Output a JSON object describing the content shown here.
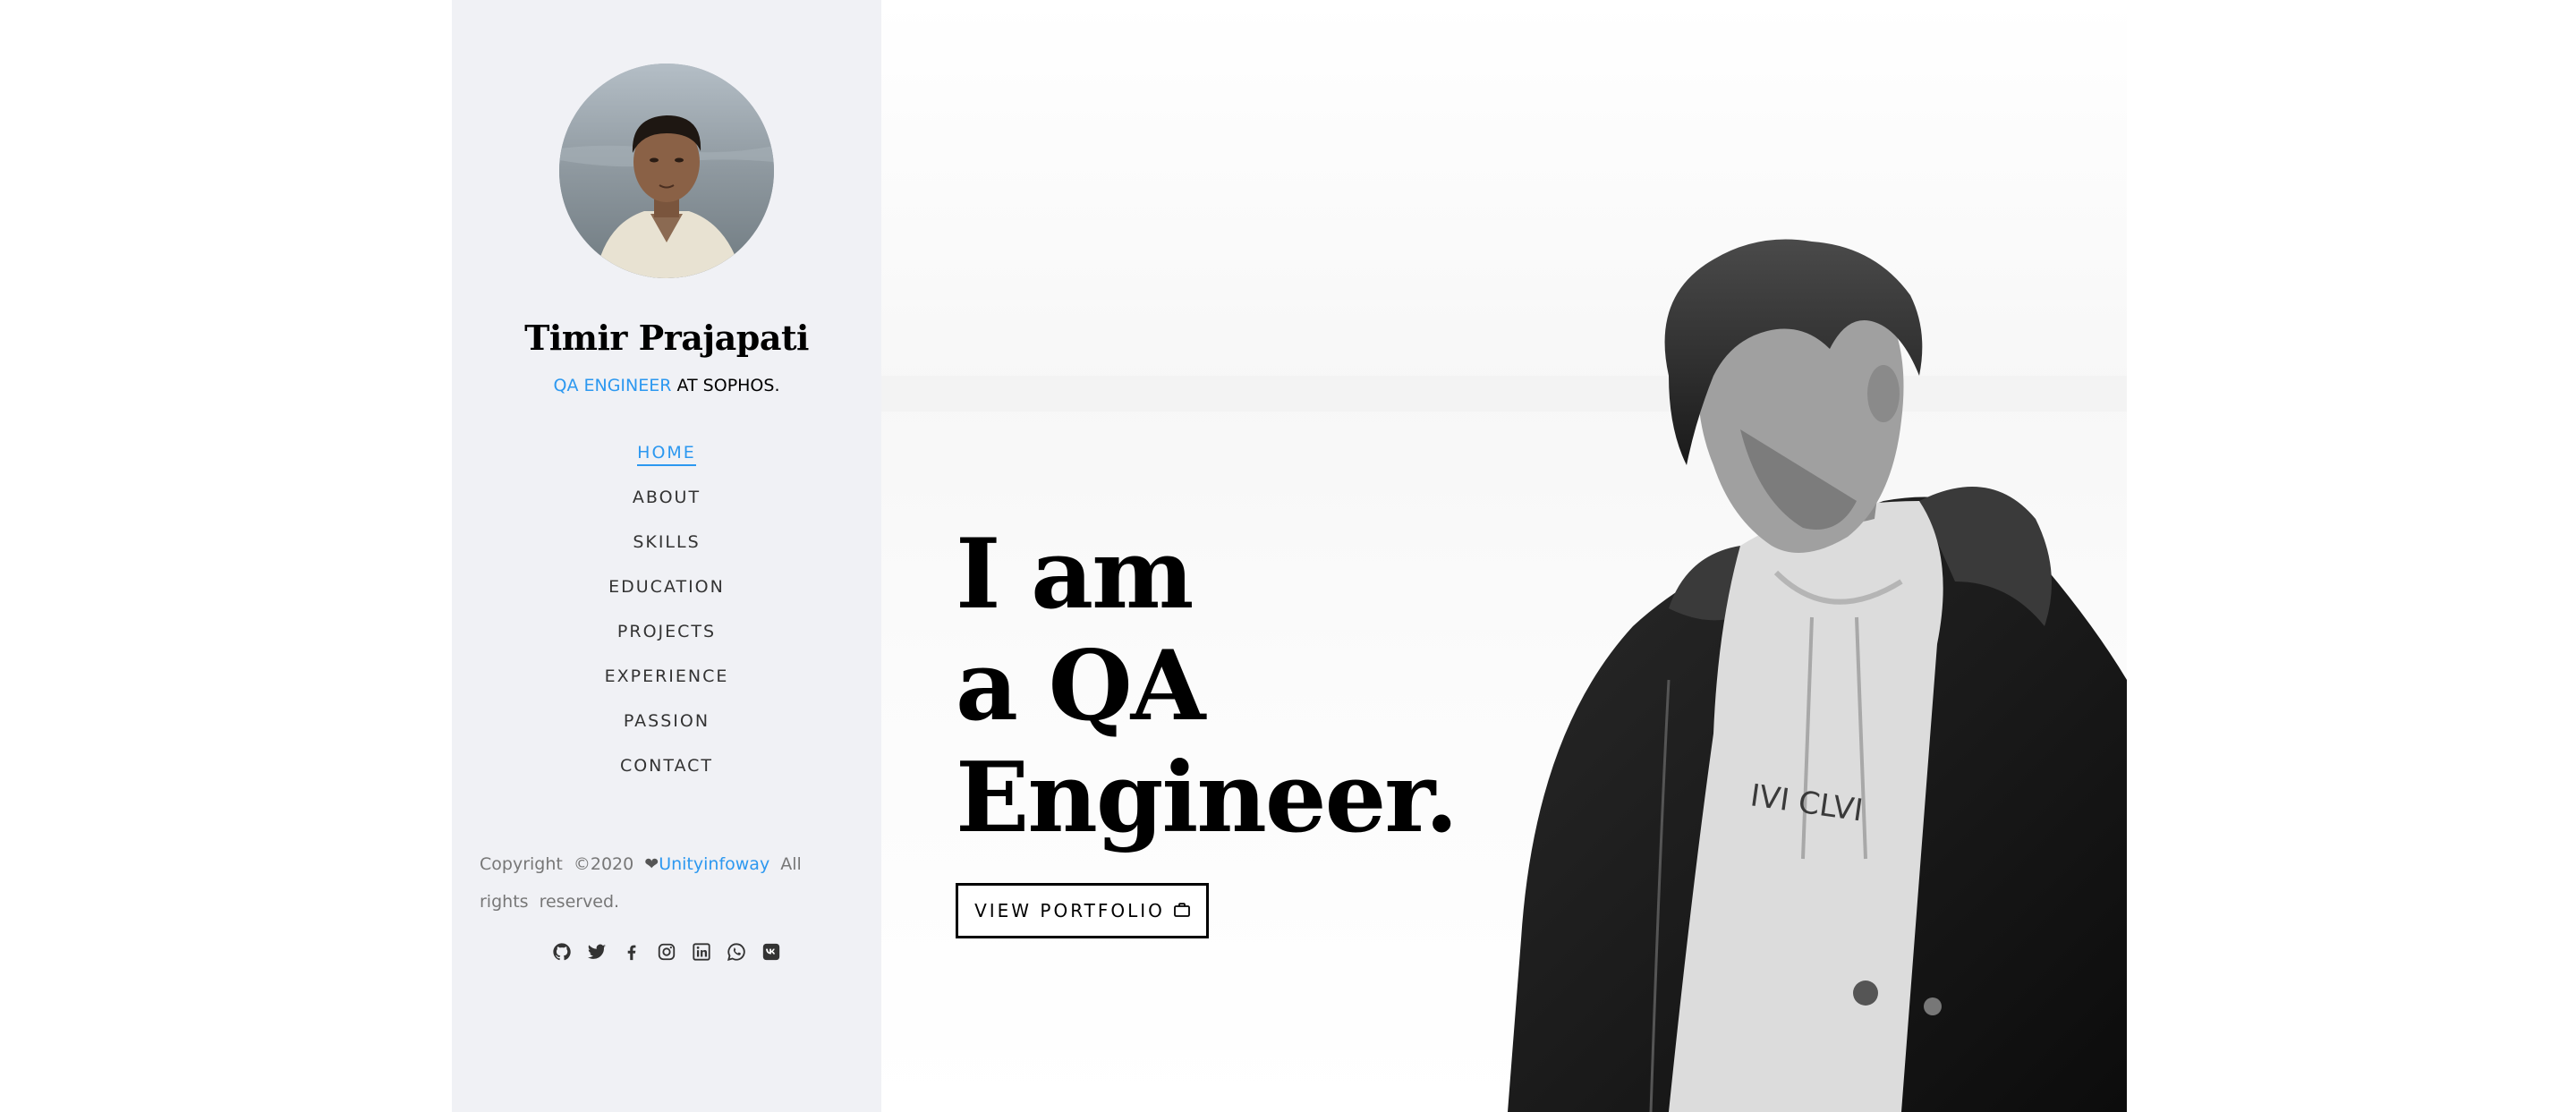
{
  "sidebar": {
    "name": "Timir Prajapati",
    "role_accent": "QA ENGINEER",
    "role_rest": " AT SOPHOS.",
    "nav": [
      {
        "label": "HOME",
        "active": true
      },
      {
        "label": "ABOUT",
        "active": false
      },
      {
        "label": "SKILLS",
        "active": false
      },
      {
        "label": "EDUCATION",
        "active": false
      },
      {
        "label": "PROJECTS",
        "active": false
      },
      {
        "label": "EXPERIENCE",
        "active": false
      },
      {
        "label": "PASSION",
        "active": false
      },
      {
        "label": "CONTACT",
        "active": false
      }
    ],
    "copyright_prefix": "Copyright ©2020 ",
    "copyright_heart": "❤",
    "copyright_link": "Unityinfoway",
    "copyright_suffix": " All rights reserved.",
    "socials": [
      "github-icon",
      "twitter-icon",
      "facebook-icon",
      "instagram-icon",
      "linkedin-icon",
      "whatsapp-icon",
      "vk-icon"
    ]
  },
  "hero": {
    "headline_line1": "I am",
    "headline_line2": "a QA",
    "headline_line3": "Engineer.",
    "button_label": "VIEW PORTFOLIO",
    "button_icon": "briefcase-icon"
  },
  "colors": {
    "accent": "#2c98f0",
    "sidebar_bg": "#f0f1f5",
    "text": "#000000"
  }
}
